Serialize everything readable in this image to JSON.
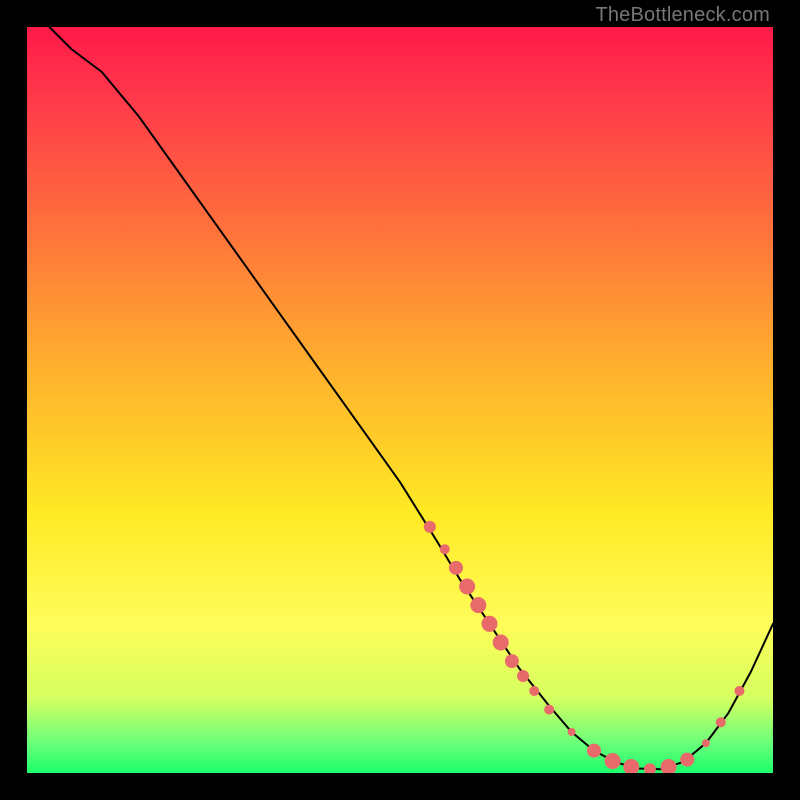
{
  "watermark": {
    "text": "TheBottleneck.com"
  },
  "chart_data": {
    "type": "line",
    "title": "",
    "xlabel": "",
    "ylabel": "",
    "xlim": [
      0,
      100
    ],
    "ylim": [
      0,
      100
    ],
    "grid": false,
    "series": [
      {
        "name": "curve",
        "x": [
          3,
          6,
          10,
          15,
          20,
          25,
          30,
          35,
          40,
          45,
          50,
          55,
          58,
          62,
          66,
          70,
          73,
          76,
          79,
          82,
          85,
          88,
          91,
          94,
          97,
          100
        ],
        "y": [
          100,
          97,
          94,
          88,
          81,
          74,
          67,
          60,
          53,
          46,
          39,
          31,
          26,
          20,
          14,
          9,
          5.5,
          3,
          1.4,
          0.6,
          0.5,
          1.5,
          4,
          8,
          13.5,
          20
        ],
        "stroke": "#000000",
        "stroke_width": 2
      }
    ],
    "markers": [
      {
        "x": 54.0,
        "y": 33.0,
        "r": 6,
        "fill": "#e86a6a"
      },
      {
        "x": 56.0,
        "y": 30.0,
        "r": 5,
        "fill": "#e86a6a"
      },
      {
        "x": 57.5,
        "y": 27.5,
        "r": 7,
        "fill": "#e86a6a"
      },
      {
        "x": 59.0,
        "y": 25.0,
        "r": 8,
        "fill": "#e86a6a"
      },
      {
        "x": 60.5,
        "y": 22.5,
        "r": 8,
        "fill": "#e86a6a"
      },
      {
        "x": 62.0,
        "y": 20.0,
        "r": 8,
        "fill": "#e86a6a"
      },
      {
        "x": 63.5,
        "y": 17.5,
        "r": 8,
        "fill": "#e86a6a"
      },
      {
        "x": 65.0,
        "y": 15.0,
        "r": 7,
        "fill": "#e86a6a"
      },
      {
        "x": 66.5,
        "y": 13.0,
        "r": 6,
        "fill": "#e86a6a"
      },
      {
        "x": 68.0,
        "y": 11.0,
        "r": 5,
        "fill": "#e86a6a"
      },
      {
        "x": 70.0,
        "y": 8.5,
        "r": 5,
        "fill": "#e86a6a"
      },
      {
        "x": 73.0,
        "y": 5.5,
        "r": 4,
        "fill": "#e86a6a"
      },
      {
        "x": 76.0,
        "y": 3.0,
        "r": 7,
        "fill": "#e86a6a"
      },
      {
        "x": 78.5,
        "y": 1.6,
        "r": 8,
        "fill": "#e86a6a"
      },
      {
        "x": 81.0,
        "y": 0.8,
        "r": 8,
        "fill": "#e86a6a"
      },
      {
        "x": 83.5,
        "y": 0.5,
        "r": 6,
        "fill": "#e86a6a"
      },
      {
        "x": 86.0,
        "y": 0.8,
        "r": 8,
        "fill": "#e86a6a"
      },
      {
        "x": 88.5,
        "y": 1.8,
        "r": 7,
        "fill": "#e86a6a"
      },
      {
        "x": 91.0,
        "y": 4.0,
        "r": 4,
        "fill": "#e86a6a"
      },
      {
        "x": 93.0,
        "y": 6.8,
        "r": 5,
        "fill": "#e86a6a"
      },
      {
        "x": 95.5,
        "y": 11.0,
        "r": 5,
        "fill": "#e86a6a"
      }
    ]
  }
}
